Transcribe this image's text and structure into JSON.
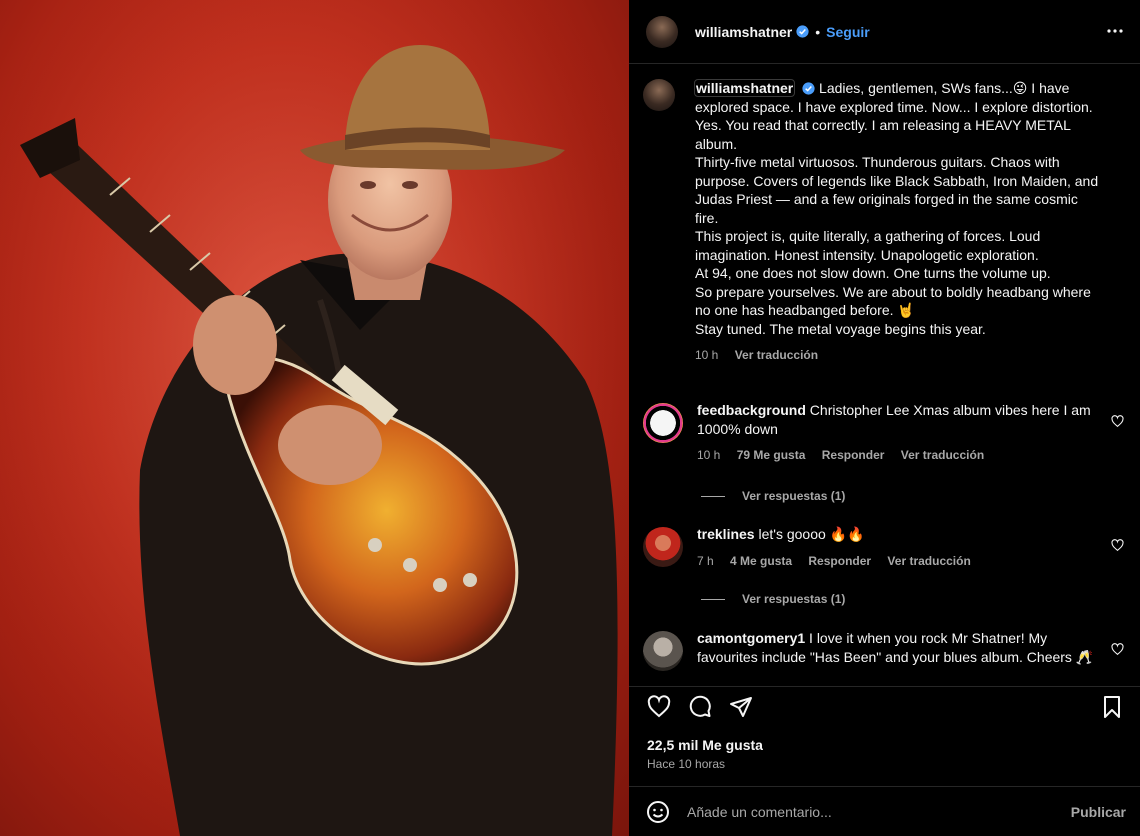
{
  "post": {
    "username": "williamshatner",
    "follow_label": "Seguir",
    "separator": "•"
  },
  "caption": {
    "username": "williamshatner",
    "lines": [
      "Ladies, gentlemen, SWs fans...😜 I have explored space. I have explored time. Now... I explore distortion.",
      "Yes. You read that correctly. I am releasing a HEAVY METAL album.",
      "Thirty-five metal virtuosos. Thunderous guitars. Chaos with purpose. Covers of legends like Black Sabbath, Iron Maiden, and Judas Priest — and a few originals forged in the same cosmic fire.",
      "This project is, quite literally, a gathering of forces. Loud imagination. Honest intensity. Unapologetic exploration.",
      "At 94, one does not slow down. One turns the volume up.",
      "So prepare yourselves. We are about to boldly headbang where no one has headbanged before. 🤘",
      "Stay tuned. The metal voyage begins this year."
    ],
    "time": "10 h",
    "translate": "Ver traducción"
  },
  "comments": [
    {
      "username": "feedbackground",
      "text": "Christopher Lee Xmas album vibes here I am 1000% down",
      "time": "10 h",
      "likes": "79 Me gusta",
      "reply": "Responder",
      "translate": "Ver traducción",
      "replies": "Ver respuestas (1)"
    },
    {
      "username": "treklines",
      "text": "let's goooo 🔥🔥",
      "time": "7 h",
      "likes": "4 Me gusta",
      "reply": "Responder",
      "translate": "Ver traducción",
      "replies": "Ver respuestas (1)"
    },
    {
      "username": "camontgomery1",
      "text": "I love it when you rock Mr Shatner! My favourites include \"Has Been\" and your blues album. Cheers 🥂"
    }
  ],
  "stats": {
    "likes": "22,5 mil Me gusta",
    "posted": "Hace 10 horas"
  },
  "composer": {
    "placeholder": "Añade un comentario...",
    "publish": "Publicar"
  },
  "icons": {
    "verified": "verified-badge-icon",
    "more": "more-options-icon",
    "like": "heart-icon",
    "comment": "comment-bubble-icon",
    "share": "paper-plane-icon",
    "save": "bookmark-icon",
    "emoji": "smiley-icon"
  },
  "colors": {
    "accent": "#4a9dfa",
    "muted": "#a8a8a8",
    "background": "#000000"
  }
}
